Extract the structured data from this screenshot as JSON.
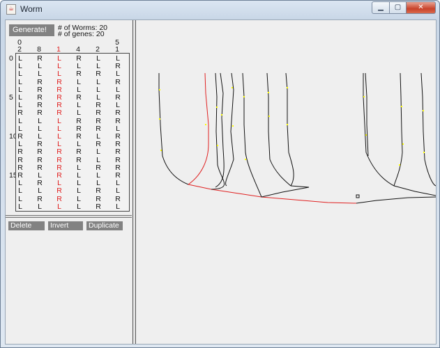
{
  "window": {
    "title": "Worm",
    "app_icon": "java-cup-icon"
  },
  "controls": {
    "generate_label": "Generate!",
    "worms_stat": "# of Worms: 20",
    "genes_stat": "# of genes: 20"
  },
  "columns": [
    {
      "top": "0",
      "sub": "2",
      "red": false
    },
    {
      "top": "",
      "sub": "8",
      "red": false
    },
    {
      "top": "",
      "sub": "1",
      "red": true
    },
    {
      "top": "",
      "sub": "4",
      "red": false
    },
    {
      "top": "",
      "sub": "2",
      "red": false
    },
    {
      "top": "5",
      "sub": "1",
      "red": false
    }
  ],
  "row_labels": [
    {
      "row": 0,
      "text": "0"
    },
    {
      "row": 5,
      "text": "5"
    },
    {
      "row": 10,
      "text": "10"
    },
    {
      "row": 15,
      "text": "15"
    }
  ],
  "genes": [
    "LRLRLL",
    "LLLLLR",
    "LLLRRL",
    "LRRLLR",
    "LRRLLL",
    "LRRRLR",
    "LRRLRL",
    "RRRLRR",
    "LLLRRR",
    "LLLRRL",
    "RLLRLR",
    "LRLLRR",
    "RRRRLR",
    "RRRRLR",
    "RRRLRR",
    "RLRLLR",
    "LRLLLL",
    "LLRLRL",
    "LRRLRR",
    "LLLLRL"
  ],
  "actions": {
    "delete_label": "Delete",
    "invert_label": "Invert",
    "duplicate_label": "Duplicate"
  },
  "tree": {
    "line_color": "#111111",
    "highlight_color": "#e02020",
    "marker_color": "#ffff00"
  }
}
